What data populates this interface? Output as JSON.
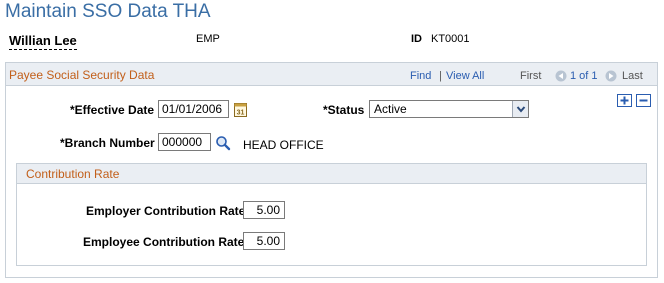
{
  "page": {
    "title": "Maintain SSO Data THA"
  },
  "employee": {
    "name": "Willian Lee",
    "type": "EMP",
    "id_label": "ID",
    "id_value": "KT0001"
  },
  "main_section": {
    "title": "Payee Social Security Data",
    "nav": {
      "find": "Find",
      "separator": "|",
      "view_all": "View All",
      "first": "First",
      "count": "1 of 1",
      "last": "Last"
    }
  },
  "fields": {
    "effective_date": {
      "required_mark": "*",
      "label": "Effective Date",
      "value": "01/01/2006"
    },
    "status": {
      "required_mark": "*",
      "label": "Status",
      "value": "Active"
    },
    "branch_number": {
      "required_mark": "*",
      "label": "Branch Number",
      "value": "000000",
      "description": "HEAD OFFICE"
    }
  },
  "contribution": {
    "title": "Contribution Rate",
    "employer": {
      "label": "Employer Contribution Rate",
      "value": "5.00"
    },
    "employee": {
      "label": "Employee Contribution Rate",
      "value": "5.00"
    }
  },
  "icons": {
    "calendar": "calendar-icon",
    "search": "search-icon",
    "add": "plus-icon",
    "delete": "minus-icon",
    "prev": "triangle-left-icon",
    "next": "triangle-right-icon",
    "dropdown": "chevron-down-icon"
  },
  "colors": {
    "title": "#3a6ea5",
    "section_title": "#c25f1a",
    "link": "#2a5db0",
    "header_bg": "#eaeef3",
    "border": "#c8d0d8"
  }
}
